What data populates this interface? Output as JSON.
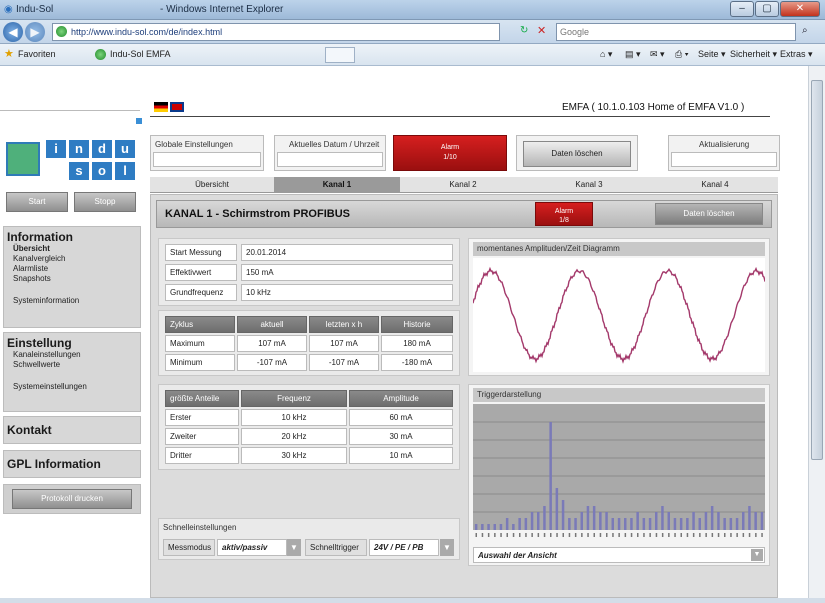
{
  "browser": {
    "window_title": "Indu-Sol",
    "window_app": "- Windows Internet Explorer",
    "url": "http://www.indu-sol.com/de/index.html",
    "search_placeholder": "Google",
    "fav_label": "Favoriten",
    "fav_site": "Indu-Sol EMFA",
    "cmd": {
      "page": "Seite ▾",
      "safety": "Sicherheit ▾",
      "extras": "Extras ▾"
    }
  },
  "header": {
    "title": "EMFA ( 10.1.0.103 Home of EMFA V1.0 )"
  },
  "logo": {
    "top": [
      "i",
      "n",
      "d",
      "u"
    ],
    "bottom": [
      "s",
      "o",
      "l"
    ]
  },
  "sidebar": {
    "start": "Start",
    "stop": "Stopp",
    "info": {
      "head": "Information",
      "items": [
        "Übersicht",
        "Kanalvergleich",
        "Alarmliste",
        "Snapshots"
      ],
      "sys": "Systeminformation"
    },
    "settings": {
      "head": "Einstellung",
      "items": [
        "Kanaleinstellungen",
        "Schwellwerte"
      ],
      "sys": "Systemeinstellungen"
    },
    "contact": "Kontakt",
    "gpl": "GPL Information",
    "print": "Protokoll drucken"
  },
  "top": {
    "global": "Globale Einstellungen",
    "datetime": "Aktuelles Datum / Uhrzeit",
    "alarm": "Alarm",
    "alarm_sub": "1/10",
    "delete": "Daten löschen",
    "refresh": "Aktualisierung"
  },
  "tabs": [
    "Übersicht",
    "Kanal 1",
    "Kanal 2",
    "Kanal 3",
    "Kanal 4"
  ],
  "channel": {
    "title": "KANAL 1 - Schirmstrom PROFIBUS",
    "alarm": "Alarm",
    "alarm_sub": "1/8",
    "delete": "Daten löschen"
  },
  "measure": [
    {
      "label": "Start Messung",
      "value": "20.01.2014"
    },
    {
      "label": "Effektivwert",
      "value": "150 mA"
    },
    {
      "label": "Grundfrequenz",
      "value": "10 kHz"
    }
  ],
  "cycle": {
    "headers": [
      "Zyklus",
      "aktuell",
      "letzten x h",
      "Historie"
    ],
    "rows": [
      [
        "Maximum",
        "107 mA",
        "107 mA",
        "180 mA"
      ],
      [
        "Minimum",
        "-107 mA",
        "-107 mA",
        "-180 mA"
      ]
    ]
  },
  "parts": {
    "headers": [
      "größte Anteile",
      "Frequenz",
      "Amplitude"
    ],
    "rows": [
      [
        "Erster",
        "10 kHz",
        "60 mA"
      ],
      [
        "Zweiter",
        "20 kHz",
        "30 mA"
      ],
      [
        "Dritter",
        "30 kHz",
        "10 mA"
      ]
    ]
  },
  "quick": {
    "title": "Schnelleinstellungen",
    "mode_label": "Messmodus",
    "mode_value": "aktiv/passiv",
    "trigger_label": "Schnelltrigger",
    "trigger_value": "24V / PE / PB"
  },
  "wave": {
    "title": "momentanes Amplituden/Zeit Diagramm"
  },
  "trigger": {
    "title": "Triggerdarstellung",
    "view": "Auswahl der Ansicht"
  },
  "chart_data": [
    {
      "type": "line",
      "title": "momentanes Amplituden/Zeit Diagramm",
      "cycles": 3.3,
      "color": "#a3386a"
    },
    {
      "type": "bar",
      "title": "Triggerdarstellung",
      "values": [
        1,
        1,
        1,
        1,
        1,
        2,
        1,
        2,
        2,
        3,
        3,
        4,
        18,
        7,
        5,
        2,
        2,
        3,
        4,
        4,
        3,
        3,
        2,
        2,
        2,
        2,
        3,
        2,
        2,
        3,
        4,
        3,
        2,
        2,
        2,
        3,
        2,
        3,
        4,
        3,
        2,
        2,
        2,
        3,
        4,
        3,
        3
      ],
      "ylim": [
        0,
        20
      ]
    }
  ],
  "colors": {
    "alarm": "#c8141c",
    "header_gray": "#7a7a7a",
    "wave": "#a3386a",
    "bars": "#7a7ab8"
  }
}
